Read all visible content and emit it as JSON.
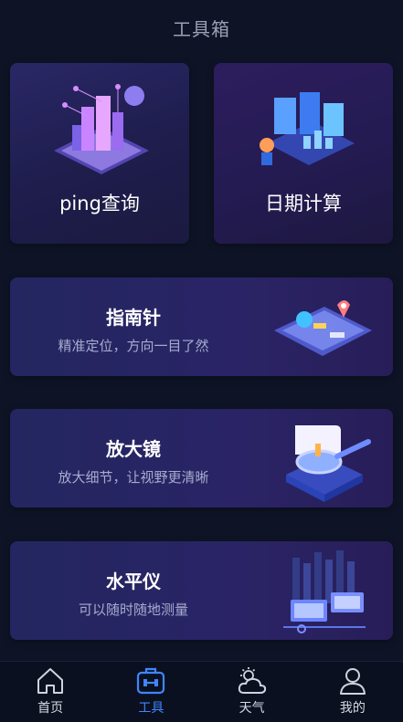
{
  "header": {
    "title": "工具箱"
  },
  "cards": {
    "ping": {
      "label": "ping查询"
    },
    "date": {
      "label": "日期计算"
    },
    "compass": {
      "title": "指南针",
      "subtitle": "精准定位，方向一目了然"
    },
    "magnifier": {
      "title": "放大镜",
      "subtitle": "放大细节，让视野更清晰"
    },
    "level": {
      "title": "水平仪",
      "subtitle": "可以随时随地测量"
    }
  },
  "tabbar": {
    "items": [
      {
        "label": "首页",
        "icon": "home-icon"
      },
      {
        "label": "工具",
        "icon": "toolbox-icon",
        "active": true
      },
      {
        "label": "天气",
        "icon": "weather-icon"
      },
      {
        "label": "我的",
        "icon": "profile-icon"
      }
    ]
  },
  "colors": {
    "accent": "#3f86ff",
    "background": "#0e1426"
  }
}
